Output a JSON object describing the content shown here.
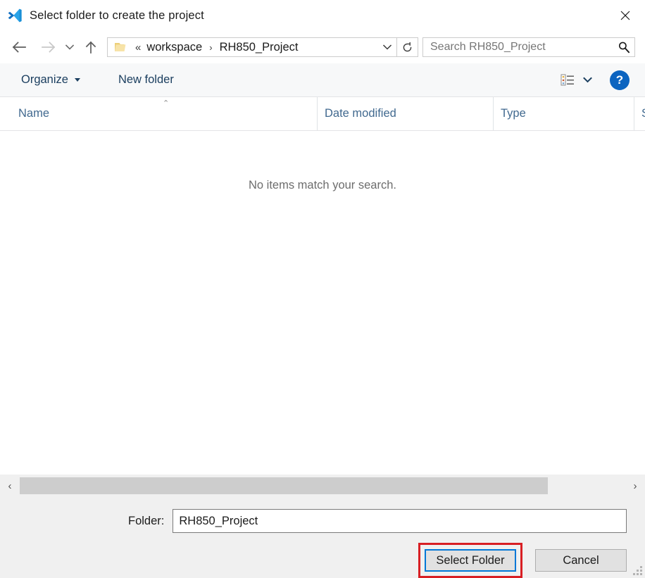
{
  "window": {
    "title": "Select folder to create the project",
    "app_icon": "vscode-logo-icon",
    "close_label": "✕"
  },
  "navigation": {
    "back_icon": "back-arrow-icon",
    "forward_icon": "forward-arrow-icon",
    "history_icon": "chevron-down-icon",
    "up_icon": "up-arrow-icon",
    "breadcrumb": {
      "folder_icon": "folder-icon",
      "overflow": "«",
      "items": [
        "workspace",
        "RH850_Project"
      ],
      "separator": "›",
      "dropdown_icon": "chevron-down-icon"
    },
    "refresh_icon": "refresh-icon",
    "refresh_glyph": "↻"
  },
  "search": {
    "placeholder": "Search RH850_Project",
    "value": "",
    "icon": "search-icon"
  },
  "command_bar": {
    "organize_label": "Organize",
    "new_folder_label": "New folder",
    "view_icon": "list-view-icon",
    "view_dropdown_icon": "chevron-down-icon",
    "help_label": "?",
    "help_icon": "help-circle-icon"
  },
  "columns": [
    {
      "label": "Name",
      "sorted": "asc",
      "sort_glyph": "⌃"
    },
    {
      "label": "Date modified",
      "sorted": ""
    },
    {
      "label": "Type",
      "sorted": ""
    },
    {
      "label": "S",
      "sorted": ""
    }
  ],
  "file_list": {
    "empty_message": "No items match your search.",
    "items": []
  },
  "scrollbar": {
    "left_arrow": "‹",
    "right_arrow": "›"
  },
  "footer": {
    "folder_label": "Folder:",
    "folder_value": "RH850_Project",
    "select_button": "Select Folder",
    "cancel_button": "Cancel"
  },
  "colors": {
    "accent": "#0078d7",
    "highlight": "#d81f24",
    "link_text": "#1c3f60",
    "column_header": "#41698f",
    "folder_icon": "#f0d48a"
  }
}
